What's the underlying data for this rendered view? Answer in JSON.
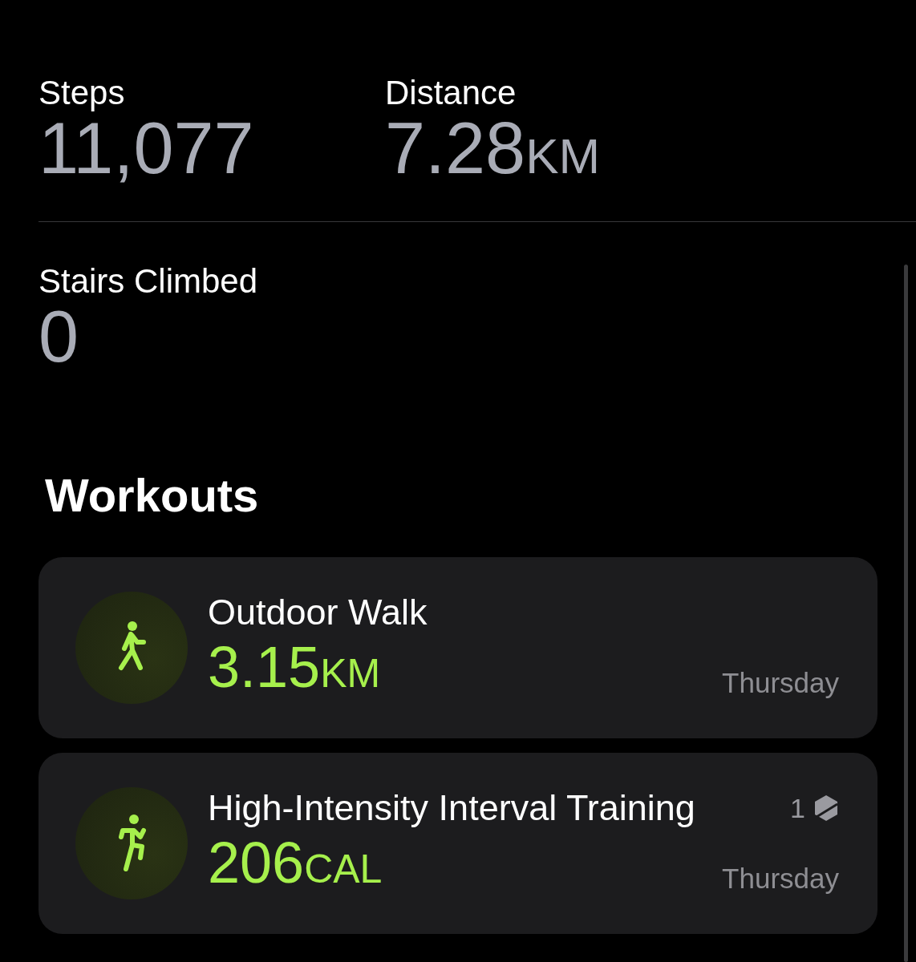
{
  "stats": [
    {
      "label": "Steps",
      "value": "11,077"
    },
    {
      "label": "Distance",
      "value": "7.28",
      "unit": "KM"
    },
    {
      "label": "Stairs Climbed",
      "value": "0"
    }
  ],
  "workouts": {
    "title": "Workouts",
    "items": [
      {
        "kind": "walk",
        "name": "Outdoor Walk",
        "value": "3.15",
        "unit": "KM",
        "day": "Thursday"
      },
      {
        "kind": "hiit",
        "name": "High-Intensity Interval Training",
        "value": "206",
        "unit": "CAL",
        "day": "Thursday",
        "badge": "1"
      }
    ]
  }
}
